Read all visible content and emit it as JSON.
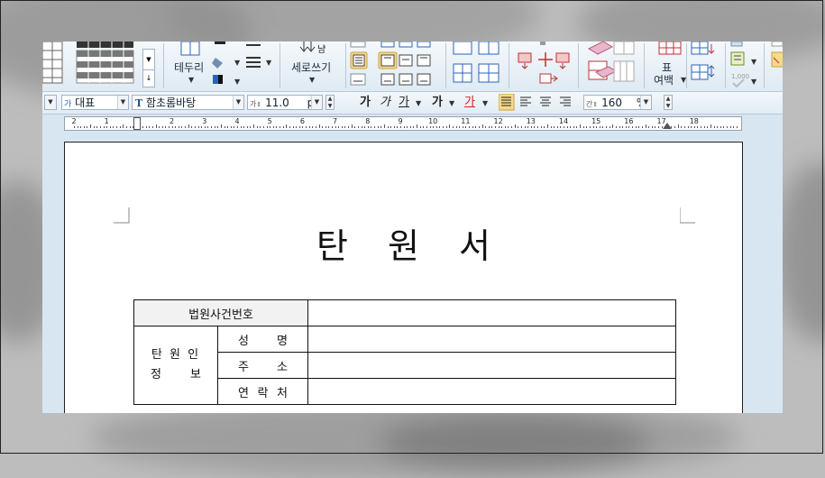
{
  "ribbon": {
    "border_label": "테두리",
    "vertical_write_label": "세로쓰기",
    "table_margin_label_1": "표",
    "table_margin_label_2": "여백"
  },
  "format_bar": {
    "style_value": "대표",
    "style_prefix": "가",
    "font_value": "함초롬바탕",
    "font_icon": "T",
    "size_prefix": "가",
    "size_value": "11.0",
    "size_unit": "pt",
    "bold_label": "가",
    "italic_label": "가",
    "underline_label": "가",
    "strike_label": "가",
    "color_label": "가",
    "linespacing_prefix": "간",
    "linespacing_value": "160",
    "linespacing_unit": "%"
  },
  "ruler": {
    "labels": [
      "2",
      "1",
      "1",
      "2",
      "3",
      "4",
      "5",
      "6",
      "7",
      "8",
      "9",
      "10",
      "11",
      "12",
      "13",
      "14",
      "15",
      "16",
      "17",
      "18"
    ]
  },
  "document": {
    "title_chars": [
      "탄",
      "원",
      "서"
    ],
    "table": {
      "case_number_label": "법원사건번호",
      "petitioner_label_line1": "탄 원 인",
      "petitioner_label_line2": [
        "정",
        "보"
      ],
      "name_label": [
        "성",
        "명"
      ],
      "address_label": [
        "주",
        "소"
      ],
      "contact_label": [
        "연",
        "락",
        "처"
      ]
    }
  },
  "colors": {
    "ribbon_bg": "#e6eef5",
    "accent": "#2a64b8",
    "red_accent": "#d02020"
  }
}
